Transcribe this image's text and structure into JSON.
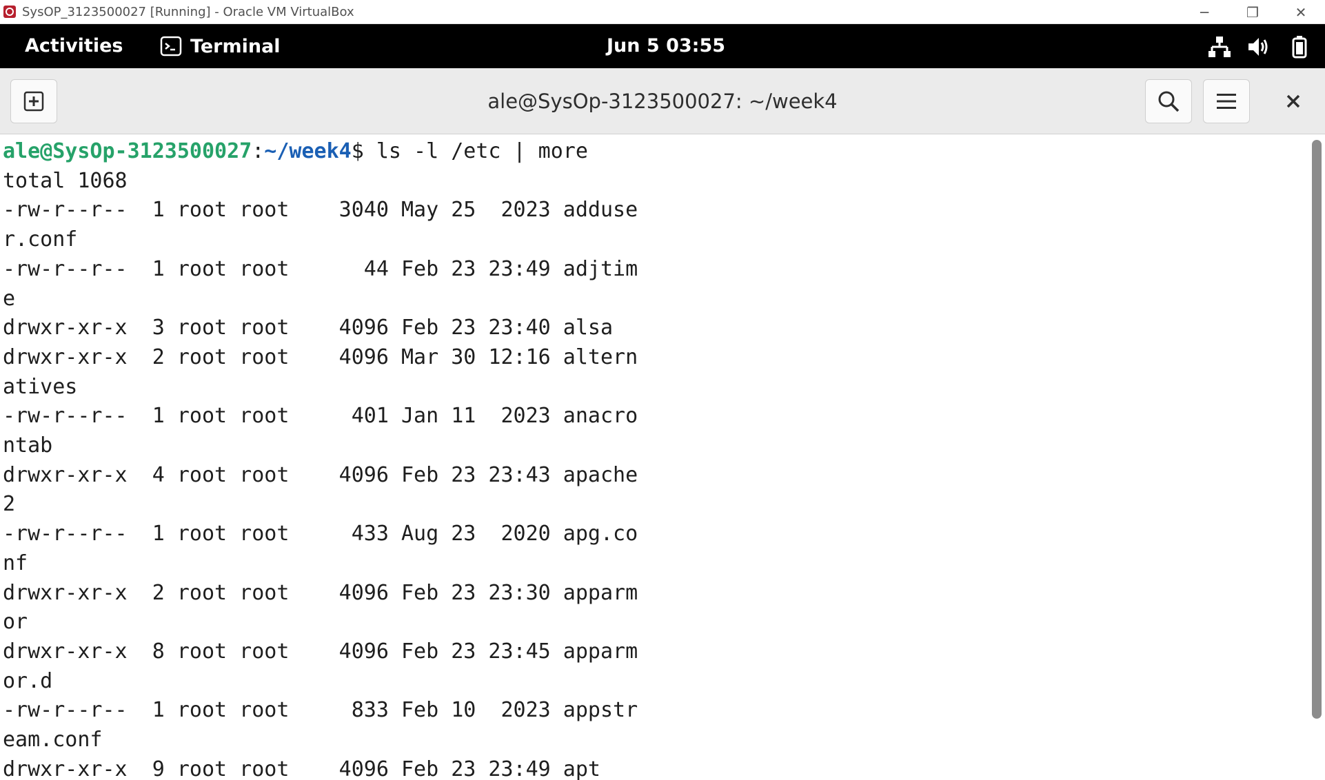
{
  "host_window": {
    "title": "SysOP_3123500027 [Running] - Oracle VM VirtualBox",
    "controls": {
      "minimize": "─",
      "restore": "❐",
      "close": "✕"
    }
  },
  "gnome_bar": {
    "activities": "Activities",
    "app_name": "Terminal",
    "clock": "Jun 5  03:55",
    "tray_icons": [
      "network-wired-icon",
      "volume-icon",
      "battery-icon"
    ]
  },
  "terminal": {
    "title": "ale@SysOp-3123500027: ~/week4",
    "prompt_user_host": "ale@SysOp-3123500027",
    "prompt_sep": ":",
    "prompt_path": "~/week4",
    "prompt_symbol": "$ ",
    "command": "ls -l /etc | more",
    "output": [
      "total 1068",
      "-rw-r--r--  1 root root    3040 May 25  2023 adduse",
      "r.conf",
      "-rw-r--r--  1 root root      44 Feb 23 23:49 adjtim",
      "e",
      "drwxr-xr-x  3 root root    4096 Feb 23 23:40 alsa",
      "drwxr-xr-x  2 root root    4096 Mar 30 12:16 altern",
      "atives",
      "-rw-r--r--  1 root root     401 Jan 11  2023 anacro",
      "ntab",
      "drwxr-xr-x  4 root root    4096 Feb 23 23:43 apache",
      "2",
      "-rw-r--r--  1 root root     433 Aug 23  2020 apg.co",
      "nf",
      "drwxr-xr-x  2 root root    4096 Feb 23 23:30 apparm",
      "or",
      "drwxr-xr-x  8 root root    4096 Feb 23 23:45 apparm",
      "or.d",
      "-rw-r--r--  1 root root     833 Feb 10  2023 appstr",
      "eam.conf",
      "drwxr-xr-x  9 root root    4096 Feb 23 23:49 apt"
    ]
  },
  "colors": {
    "prompt_user": "#26a269",
    "prompt_path": "#1a5fb4",
    "top_bar": "#000000",
    "header_bar": "#ebebeb"
  }
}
